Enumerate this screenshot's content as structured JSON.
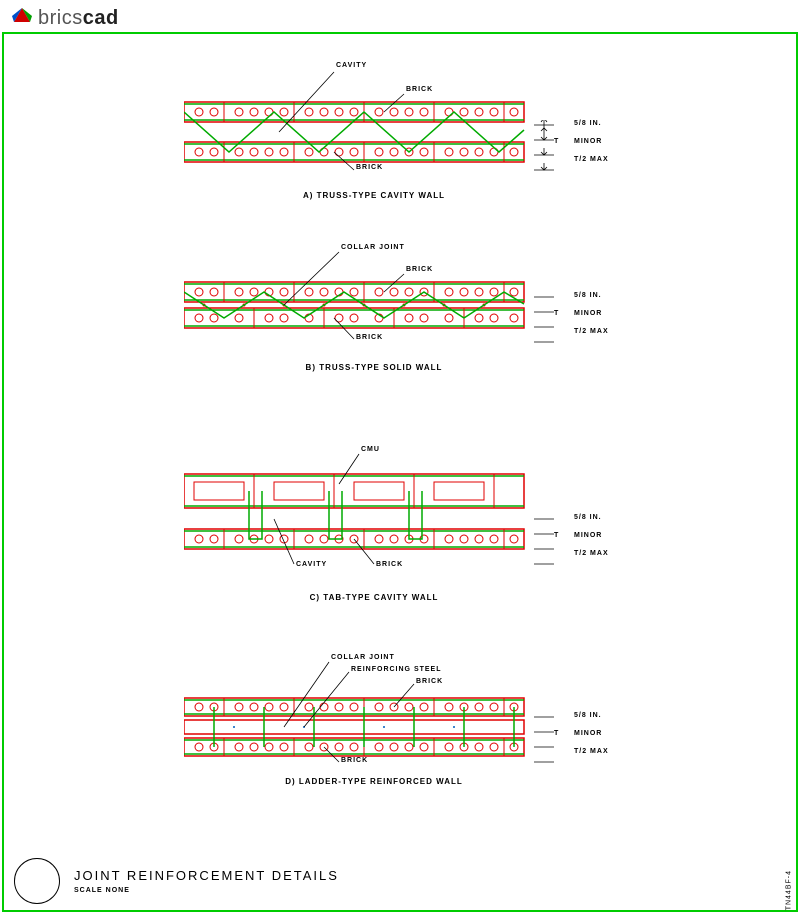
{
  "brand": {
    "part1": "brics",
    "part2": "cad"
  },
  "figures": {
    "a": {
      "caption": "A) TRUSS-TYPE CAVITY WALL",
      "labels": {
        "cavity": "CAVITY",
        "brick_top": "BRICK",
        "brick_bottom": "BRICK"
      }
    },
    "b": {
      "caption": "B) TRUSS-TYPE SOLID WALL",
      "labels": {
        "collar": "COLLAR JOINT",
        "brick_top": "BRICK",
        "brick_bottom": "BRICK"
      }
    },
    "c": {
      "caption": "C) TAB-TYPE CAVITY WALL",
      "labels": {
        "cmu": "CMU",
        "cavity": "CAVITY",
        "brick": "BRICK"
      }
    },
    "d": {
      "caption": "D) LADDER-TYPE REINFORCED WALL",
      "labels": {
        "collar": "COLLAR JOINT",
        "steel": "REINFORCING STEEL",
        "brick_top": "BRICK",
        "brick_bottom": "BRICK"
      }
    }
  },
  "dims": {
    "d1": "5/8 IN.",
    "d2": "MINOR",
    "d3": "T/2 MAX",
    "t": "T"
  },
  "title": {
    "main": "JOINT REINFORCEMENT DETAILS",
    "scale": "SCALE NONE"
  },
  "side": "TN44BF-4"
}
